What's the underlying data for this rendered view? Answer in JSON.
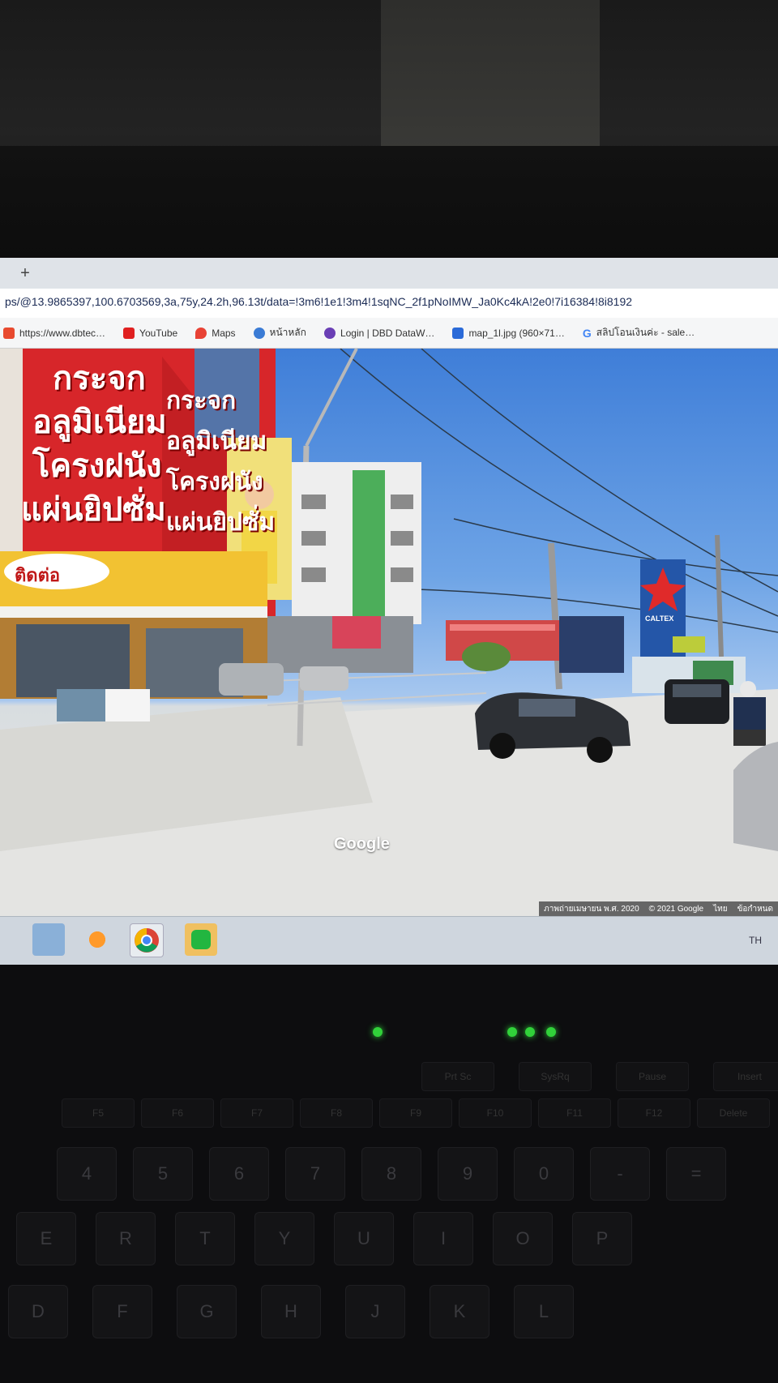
{
  "browser": {
    "new_tab_icon": "plus-icon",
    "url": "ps/@13.9865397,100.6703569,3a,75y,24.2h,96.13t/data=!3m6!1e1!3m4!1sqNC_2f1pNoIMW_Ja0Kc4kA!2e0!7i16384!8i8192",
    "bookmarks": [
      {
        "label": "https://www.dbtec…",
        "icon": "page-icon",
        "color": "#e84a2f"
      },
      {
        "label": "YouTube",
        "icon": "youtube-icon",
        "color": "#e02020"
      },
      {
        "label": "Maps",
        "icon": "maps-pin-icon",
        "color": "#e84235"
      },
      {
        "label": "หน้าหลัก",
        "icon": "globe-icon",
        "color": "#3a7bd5"
      },
      {
        "label": "Login | DBD DataW…",
        "icon": "dbd-icon",
        "color": "#6a3fb5"
      },
      {
        "label": "map_1l.jpg (960×71…",
        "icon": "image-icon",
        "color": "#2a6ad8"
      },
      {
        "label": "สลิปโอนเงินค่ะ - sale…",
        "icon": "google-icon",
        "color": "#4285f4"
      }
    ]
  },
  "streetview": {
    "shop_sign_lines": [
      "กระจก",
      "อลูมิเนียม",
      "โครงฝนัง",
      "แผ่นยิปซั่ม"
    ],
    "side_sign_lines": [
      "กระจก",
      "อลูมิเนียม",
      "โครงฝนัง",
      "แผ่นยิปซั่ม"
    ],
    "canopy_text": "ติดต่อ",
    "gas_station_brand": "CALTEX",
    "google_logo": "Google",
    "attribution": {
      "capture_date": "ภาพถ่ายเมษายน พ.ศ. 2020",
      "copyright": "© 2021 Google",
      "language": "ไทย",
      "terms": "ข้อกำหนด"
    }
  },
  "taskbar": {
    "icons": [
      "app-icon",
      "media-player-icon",
      "chrome-icon",
      "line-icon"
    ],
    "tray_lang": "TH"
  },
  "keyboard": {
    "function_keys": [
      "F5",
      "F6",
      "F7",
      "F8",
      "F9",
      "F10",
      "F11",
      "F12"
    ],
    "number_row": [
      "4",
      "5",
      "6",
      "7",
      "8",
      "9",
      "0",
      "-",
      "="
    ],
    "top_row": [
      "E",
      "R",
      "T",
      "Y",
      "U",
      "I",
      "O",
      "P"
    ],
    "home_row": [
      "D",
      "F",
      "G",
      "H",
      "J",
      "K",
      "L"
    ],
    "nav_keys": [
      "Prt Sc",
      "SysRq",
      "Pause",
      "Insert",
      "Delete"
    ]
  },
  "colors": {
    "sign_red": "#d7262a",
    "sign_yellow": "#f2c232",
    "sky_blue": "#4a86db",
    "led_green": "#31d13a"
  }
}
